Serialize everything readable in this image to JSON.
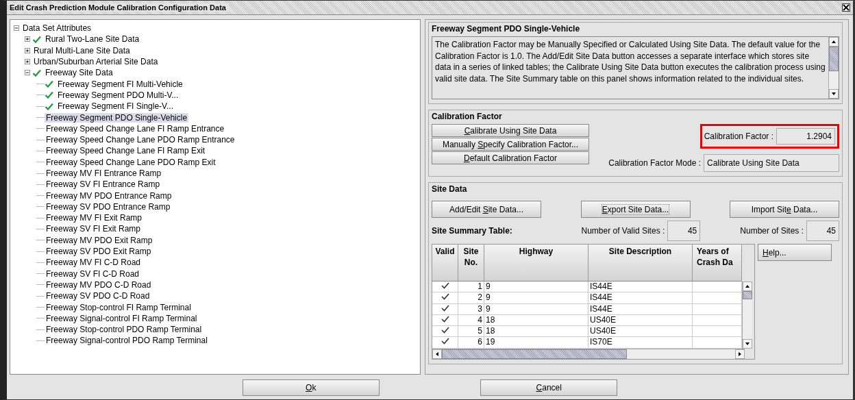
{
  "window": {
    "title": "Edit Crash Prediction Module Calibration Configuration Data"
  },
  "tree": {
    "label": "Data Set Attributes",
    "kind": "branch",
    "expanded": true,
    "checked": false,
    "selected": false,
    "children": [
      {
        "label": "Rural Two-Lane Site Data",
        "kind": "branch",
        "expanded": false,
        "checked": true,
        "selected": false
      },
      {
        "label": "Rural Multi-Lane Site Data",
        "kind": "branch",
        "expanded": false,
        "checked": false,
        "selected": false
      },
      {
        "label": "Urban/Suburban Arterial Site Data",
        "kind": "branch",
        "expanded": false,
        "checked": false,
        "selected": false
      },
      {
        "label": "Freeway Site Data",
        "kind": "branch",
        "expanded": true,
        "checked": true,
        "selected": false,
        "children": [
          {
            "label": "Freeway Segment FI Multi-Vehicle",
            "kind": "leaf",
            "checked": true,
            "selected": false
          },
          {
            "label": "Freeway Segment PDO Multi-V...",
            "kind": "leaf",
            "checked": true,
            "selected": false
          },
          {
            "label": "Freeway Segment FI Single-V...",
            "kind": "leaf",
            "checked": true,
            "selected": false
          },
          {
            "label": "Freeway Segment PDO Single-Vehicle",
            "kind": "leaf",
            "checked": false,
            "selected": true
          },
          {
            "label": "Freeway Speed Change Lane FI Ramp Entrance",
            "kind": "leaf",
            "checked": false,
            "selected": false
          },
          {
            "label": "Freeway Speed Change Lane PDO Ramp Entrance",
            "kind": "leaf",
            "checked": false,
            "selected": false
          },
          {
            "label": "Freeway Speed Change Lane FI Ramp Exit",
            "kind": "leaf",
            "checked": false,
            "selected": false
          },
          {
            "label": "Freeway Speed Change Lane PDO Ramp Exit",
            "kind": "leaf",
            "checked": false,
            "selected": false
          },
          {
            "label": "Freeway MV FI Entrance Ramp",
            "kind": "leaf",
            "checked": false,
            "selected": false
          },
          {
            "label": "Freeway SV FI Entrance Ramp",
            "kind": "leaf",
            "checked": false,
            "selected": false
          },
          {
            "label": "Freeway MV PDO Entrance Ramp",
            "kind": "leaf",
            "checked": false,
            "selected": false
          },
          {
            "label": "Freeway SV PDO Entrance Ramp",
            "kind": "leaf",
            "checked": false,
            "selected": false
          },
          {
            "label": "Freeway MV FI Exit Ramp",
            "kind": "leaf",
            "checked": false,
            "selected": false
          },
          {
            "label": "Freeway SV FI Exit Ramp",
            "kind": "leaf",
            "checked": false,
            "selected": false
          },
          {
            "label": "Freeway MV PDO Exit Ramp",
            "kind": "leaf",
            "checked": false,
            "selected": false
          },
          {
            "label": "Freeway SV PDO Exit Ramp",
            "kind": "leaf",
            "checked": false,
            "selected": false
          },
          {
            "label": "Freeway MV FI C-D Road",
            "kind": "leaf",
            "checked": false,
            "selected": false
          },
          {
            "label": "Freeway SV FI C-D Road",
            "kind": "leaf",
            "checked": false,
            "selected": false
          },
          {
            "label": "Freeway MV PDO C-D Road",
            "kind": "leaf",
            "checked": false,
            "selected": false
          },
          {
            "label": "Freeway SV PDO C-D Road",
            "kind": "leaf",
            "checked": false,
            "selected": false
          },
          {
            "label": "Freeway Stop-control FI Ramp Terminal",
            "kind": "leaf",
            "checked": false,
            "selected": false
          },
          {
            "label": "Freeway Signal-control FI Ramp Terminal",
            "kind": "leaf",
            "checked": false,
            "selected": false
          },
          {
            "label": "Freeway Stop-control PDO Ramp Terminal",
            "kind": "leaf",
            "checked": false,
            "selected": false
          },
          {
            "label": "Freeway Signal-control PDO Ramp Terminal",
            "kind": "leaf",
            "checked": false,
            "selected": false
          }
        ]
      }
    ]
  },
  "panel": {
    "title": "Freeway Segment PDO Single-Vehicle",
    "description": "The Calibration Factor may be Manually Specified or Calculated Using Site Data. The default value for the Calibration Factor is 1.0. The Add/Edit Site Data button accesses a separate interface which stores site data in a series of linked tables; the Calibrate Using Site Data button executes the calibration process using valid site data. The Site Summary table on this panel shows information related to the individual sites.",
    "calibration": {
      "title": "Calibration Factor",
      "buttons": [
        {
          "label": {
            "key": "C",
            "after": "alibrate Using Site Data"
          }
        },
        {
          "label": {
            "before": "Manually ",
            "key": "S",
            "after": "pecify Calibration Factor..."
          }
        },
        {
          "label": {
            "key": "D",
            "after": "efault Calibration Factor"
          }
        }
      ],
      "factor": {
        "label": "Calibration Factor :",
        "value": "1.2904",
        "highlighted": true
      },
      "mode": {
        "label": "Calibration Factor Mode :",
        "value": "Calibrate Using Site Data"
      }
    },
    "site_data": {
      "title": "Site Data",
      "buttons": [
        {
          "label": {
            "before": "Add/Edit ",
            "key": "S",
            "after": "ite Data..."
          },
          "focused": false
        },
        {
          "label": {
            "key": "E",
            "after": "xport Site Data..."
          },
          "focused": true
        },
        {
          "label": {
            "before": "Import Sit",
            "key": "e",
            "after": " Data..."
          },
          "focused": false
        }
      ],
      "summary_label": "Site Summary Table:",
      "valid_sites": {
        "label": "Number of Valid Sites :",
        "value": "45"
      },
      "sites": {
        "label": "Number of Sites :",
        "value": "45"
      },
      "table": {
        "columns": [
          "Valid",
          "Site No.",
          "Highway",
          "Site Description",
          "Years of Crash Da"
        ],
        "rows": [
          {
            "valid": true,
            "site_no": "1",
            "highway": "9",
            "description": "IS44E"
          },
          {
            "valid": true,
            "site_no": "2",
            "highway": "9",
            "description": "IS44E"
          },
          {
            "valid": true,
            "site_no": "3",
            "highway": "9",
            "description": "IS44E"
          },
          {
            "valid": true,
            "site_no": "4",
            "highway": "18",
            "description": "US40E"
          },
          {
            "valid": true,
            "site_no": "5",
            "highway": "18",
            "description": "US40E"
          },
          {
            "valid": true,
            "site_no": "6",
            "highway": "19",
            "description": "IS70E"
          }
        ]
      },
      "help_button": {
        "label": {
          "key": "H",
          "after": "elp..."
        }
      }
    }
  },
  "footer": {
    "buttons": [
      {
        "label": {
          "key": "O",
          "after": "k"
        }
      },
      {
        "label": {
          "key": "C",
          "after": "ancel"
        }
      }
    ]
  }
}
